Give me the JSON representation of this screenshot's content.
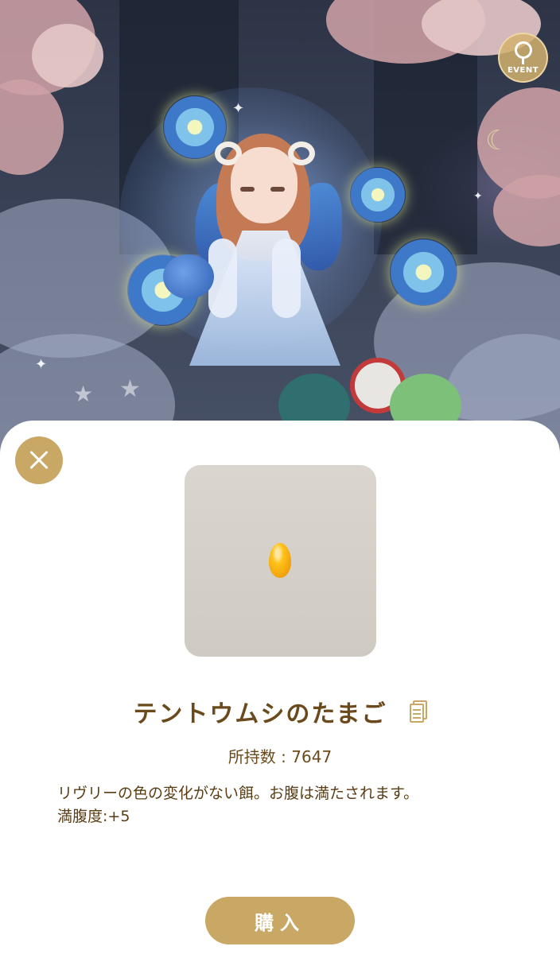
{
  "event_badge": {
    "label": "EVENT",
    "icon": "female-symbol-icon"
  },
  "item": {
    "name": "テントウムシのたまご",
    "owned_label": "所持数 : 7647",
    "description": "リヴリーの色の変化がない餌。お腹は満たされます。",
    "satiety": "満腹度:+5"
  },
  "buttons": {
    "close_icon": "close-icon",
    "buy_label": "購入"
  },
  "colors": {
    "accent_gold": "#c9a765",
    "text_brown": "#6a4a1c",
    "card_bg": "#d6d2ca",
    "egg": "#f5aa10"
  }
}
